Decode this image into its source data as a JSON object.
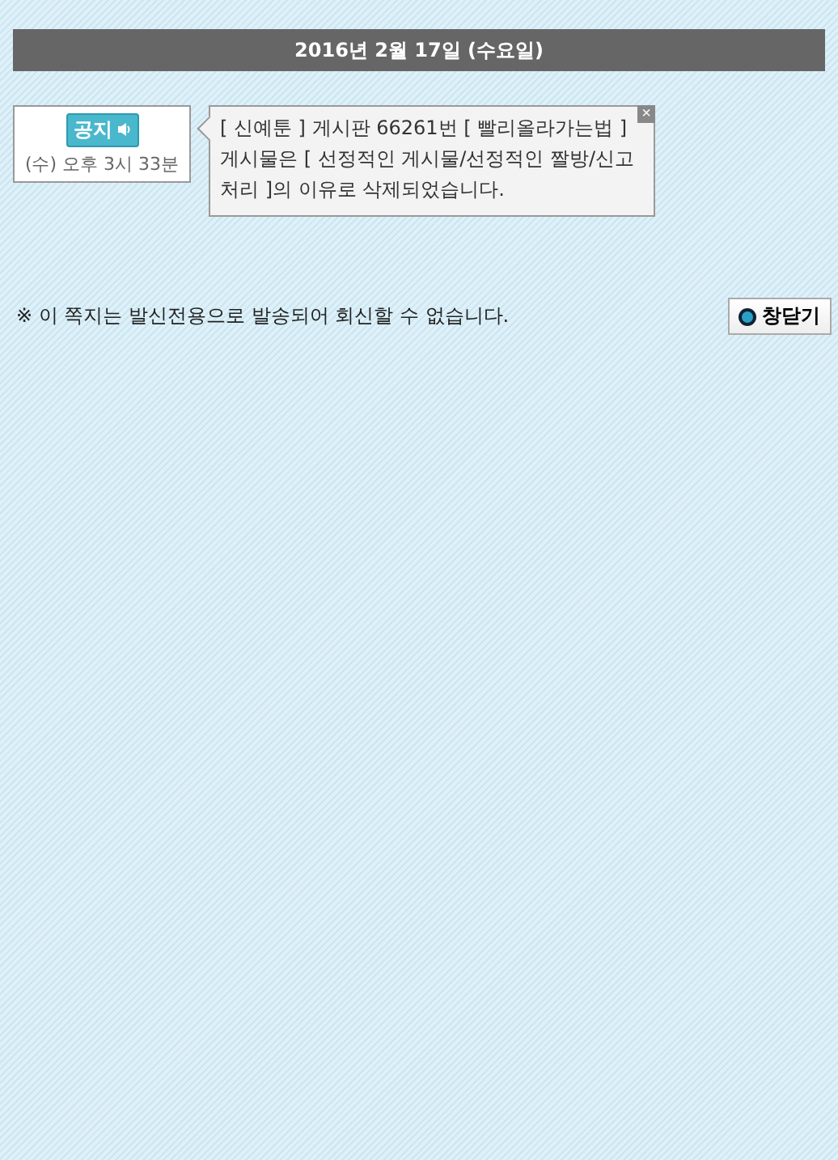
{
  "date_header": "2016년 2월 17일 (수요일)",
  "message": {
    "badge": "공지",
    "time": "(수) 오후 3시 33분",
    "body": "[ 신예툰 ] 게시판 66261번 [ 빨리올라가는법 ] 게시물은 [ 선정적인 게시물/선정적인 짤방/신고처리 ]의 이유로 삭제되었습니다.",
    "close": "×"
  },
  "notice": "※ 이 쪽지는 발신전용으로 발송되어 회신할 수 없습니다.",
  "close_window_button": "창닫기"
}
